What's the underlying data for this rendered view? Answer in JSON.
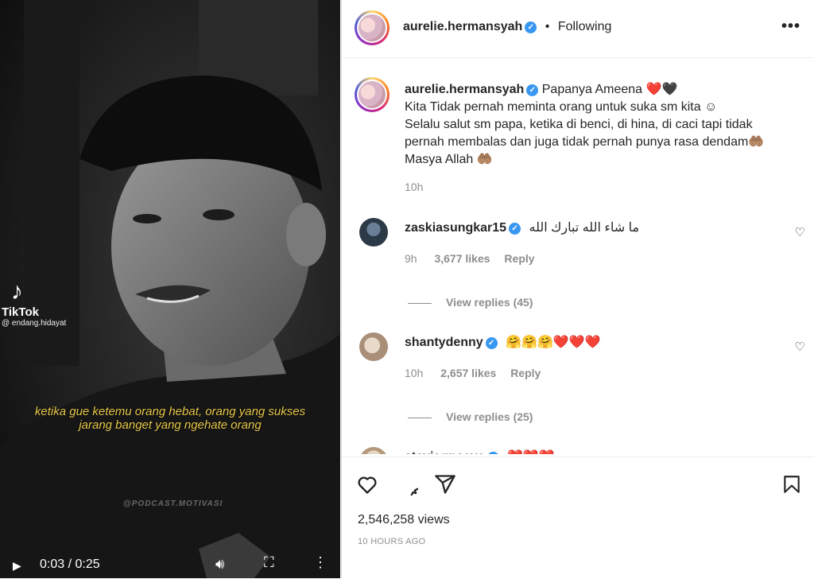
{
  "video": {
    "tiktok_brand": "TikTok",
    "tiktok_handle": "@ endang.hidayat",
    "subtitle_line1": "ketika gue ketemu orang hebat, orang yang sukses",
    "subtitle_line2": "jarang banget yang ngehate orang",
    "watermark": "@PODCAST.MOTIVASI",
    "time": "0:03 / 0:25"
  },
  "header": {
    "username": "aurelie.hermansyah",
    "separator": "•",
    "follow_status": "Following"
  },
  "caption": {
    "username": "aurelie.hermansyah",
    "line1": "Papanya Ameena",
    "line1_emoji": "❤️🖤",
    "line2": "Kita Tidak pernah meminta orang untuk suka sm kita ☺",
    "line3": "Selalu salut sm papa, ketika di benci, di hina, di caci tapi tidak",
    "line4": "pernah membalas dan juga tidak pernah punya rasa dendam🤲🏽",
    "line5": "Masya Allah 🤲🏽",
    "time": "10h"
  },
  "comments": [
    {
      "username": "zaskiasungkar15",
      "text": "ما شاء الله تبارك الله",
      "time": "9h",
      "likes": "3,677 likes",
      "reply": "Reply",
      "view_replies": "View replies (45)"
    },
    {
      "username": "shantydenny",
      "text_hugs": "🤗🤗🤗",
      "text_hearts": "❤️❤️❤️",
      "time": "10h",
      "likes": "2,657 likes",
      "reply": "Reply",
      "view_replies": "View replies (25)"
    },
    {
      "username": "steviagnecya",
      "text_hearts": "❤️❤️❤️"
    }
  ],
  "footer": {
    "views": "2,546,258 views",
    "posted": "10 HOURS AGO"
  },
  "colors": {
    "verified": "#3897f0",
    "heart": "#ed4956",
    "muted_text": "#8e8e8e",
    "subtitle_yellow": "#e8c84a"
  },
  "icons": [
    "play-icon",
    "volume-icon",
    "fullscreen-icon",
    "video-more-icon",
    "tiktok-icon",
    "verified-icon",
    "more-options-icon",
    "heart-icon",
    "comment-icon",
    "share-icon",
    "bookmark-icon"
  ]
}
